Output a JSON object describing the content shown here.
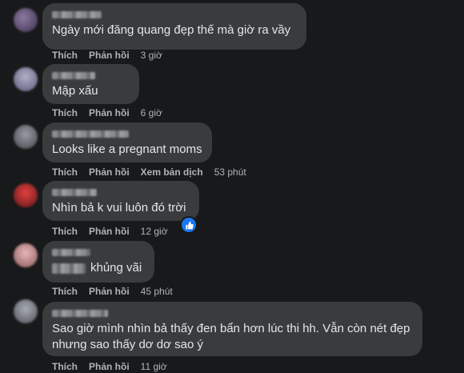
{
  "comments": [
    {
      "text": "Ngày mới đăng quang đẹp thế mà giờ ra vầy",
      "actions": [
        "Thích",
        "Phản hồi"
      ],
      "time": "3 giờ",
      "avatar_color": "#5a4a6a"
    },
    {
      "text": "Mập xấu",
      "actions": [
        "Thích",
        "Phản hồi"
      ],
      "time": "6 giờ",
      "avatar_color": "#7a7a9a"
    },
    {
      "text": "Looks like a pregnant moms",
      "actions": [
        "Thích",
        "Phản hồi",
        "Xem bản dịch"
      ],
      "time": "53 phút",
      "avatar_color": "#6a6a72"
    },
    {
      "text": "Nhìn bả k vui luôn đó trời",
      "actions": [
        "Thích",
        "Phản hồi"
      ],
      "time": "12 giờ",
      "avatar_color": "#b03030",
      "reaction": "like"
    },
    {
      "text": "khủng vãi",
      "actions": [
        "Thích",
        "Phản hồi"
      ],
      "time": "45 phút",
      "avatar_color": "#c89a9a"
    },
    {
      "text": "Sao giờ mình nhìn bả thấy đen bẩn hơn lúc thi hh. Vẫn còn nét đẹp\nnhưng sao thấy dơ dơ sao ý",
      "actions": [
        "Thích",
        "Phản hồi"
      ],
      "time": "11 giờ",
      "avatar_color": "#7a7d84"
    }
  ],
  "colors": {
    "background": "#18191a",
    "bubble": "#3a3b3c",
    "text": "#e4e6eb",
    "secondary": "#b0b3b8",
    "like_blue": "#1877f2"
  }
}
